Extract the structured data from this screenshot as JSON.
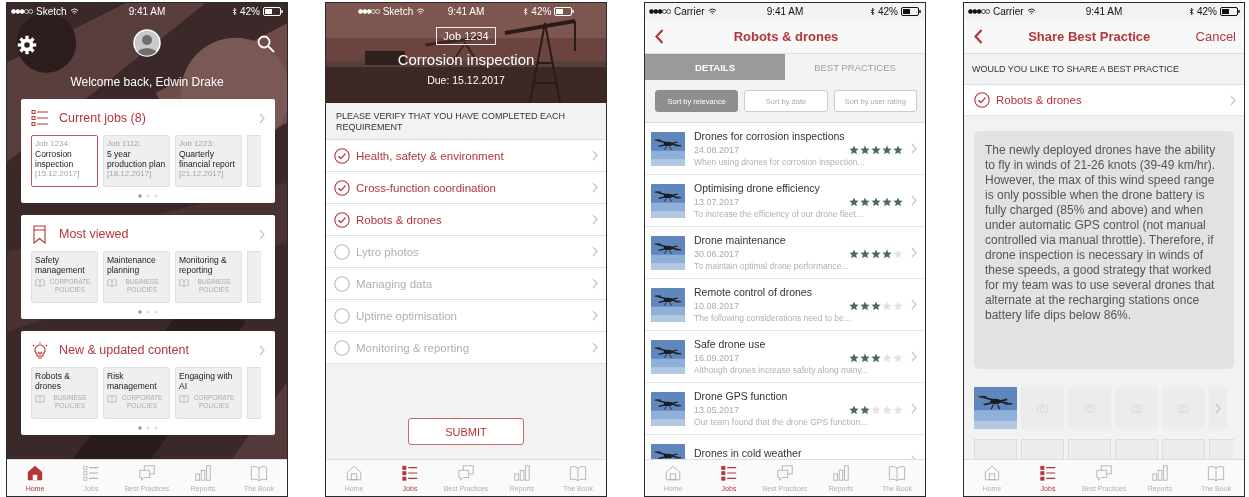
{
  "screens": [
    {
      "kind": "home",
      "status_bar": {
        "carrier": "Sketch",
        "time": "9:41 AM",
        "battery": "42%"
      },
      "greeting": "Welcome back, Edwin Drake",
      "sections": [
        {
          "kind": "jobs",
          "title": "Current jobs (8)",
          "tiles": [
            {
              "label": "Job 1234:",
              "title": "Corrosion inspection",
              "date": "[15.12.2017]",
              "selected": true
            },
            {
              "label": "Job 1112:",
              "title": "5 year production plan",
              "date": "[18.12.2017]",
              "selected": false
            },
            {
              "label": "Job 1223:",
              "title": "Quarterly financial report",
              "date": "[21.12.2017]",
              "selected": false
            }
          ]
        },
        {
          "kind": "viewed",
          "title": "Most viewed",
          "tiles": [
            {
              "title": "Safety management",
              "category": "CORPORATE POLICIES"
            },
            {
              "title": "Maintenance planning",
              "category": "BUSINESS POLICIES"
            },
            {
              "title": "Monitoring & reporting",
              "category": "BUSINESS POLICIES"
            }
          ]
        },
        {
          "kind": "new",
          "title": "New & updated content",
          "tiles": [
            {
              "title": "Robots & drones",
              "category": "BUSINESS POLICIES"
            },
            {
              "title": "Risk management",
              "category": "CORPORATE POLICIES"
            },
            {
              "title": "Engaging with AI",
              "category": "CORPORATE POLICIES"
            }
          ]
        }
      ],
      "tab_bar": [
        {
          "label": "Home",
          "selected": true
        },
        {
          "label": "Jobs",
          "selected": false
        },
        {
          "label": "Best Practices",
          "selected": false
        },
        {
          "label": "Reports",
          "selected": false
        },
        {
          "label": "The Book",
          "selected": false
        }
      ]
    },
    {
      "kind": "checklist",
      "status_bar": {
        "carrier": "Sketch",
        "time": "9:41 AM",
        "battery": "42%"
      },
      "job_badge": "Job 1234",
      "title": "Corrosion inspection",
      "due": "Due: 15.12.2017",
      "instruction": "PLEASE VERIFY THAT YOU HAVE COMPLETED EACH REQUIREMENT",
      "requirements": [
        {
          "label": "Health, safety & environment",
          "checked": true
        },
        {
          "label": "Cross-function coordination",
          "checked": true
        },
        {
          "label": "Robots & drones",
          "checked": true
        },
        {
          "label": "Lytro photos",
          "checked": false
        },
        {
          "label": "Managing data",
          "checked": false
        },
        {
          "label": "Uptime optimisation",
          "checked": false
        },
        {
          "label": "Monitoring & reporting",
          "checked": false
        }
      ],
      "submit": "SUBMIT",
      "tab_bar": [
        {
          "label": "Home",
          "selected": false
        },
        {
          "label": "Jobs",
          "selected": true
        },
        {
          "label": "Best Practices",
          "selected": false
        },
        {
          "label": "Reports",
          "selected": false
        },
        {
          "label": "The Book",
          "selected": false
        }
      ]
    },
    {
      "kind": "list",
      "status_bar": {
        "carrier": "Carrier",
        "time": "9:41 AM",
        "battery": "42%"
      },
      "title": "Robots & drones",
      "tabs": [
        {
          "label": "DETAILS",
          "selected": true
        },
        {
          "label": "BEST PRACTICES",
          "selected": false
        }
      ],
      "sort_options": [
        {
          "label": "Sort by relevance",
          "selected": true
        },
        {
          "label": "Sort by date",
          "selected": false
        },
        {
          "label": "Sort by user rating",
          "selected": false
        }
      ],
      "items": [
        {
          "title": "Drones for corrosion inspections",
          "date": "24.08.2017",
          "stars": 5,
          "snippet": "When using drones for corrosion inspection..."
        },
        {
          "title": "Optimising drone efficiency",
          "date": "13.07.2017",
          "stars": 5,
          "snippet": "To increase the efficiency of our drone fleet..."
        },
        {
          "title": "Drone maintenance",
          "date": "30.06.2017",
          "stars": 4,
          "snippet": "To maintain optimal drone performance..."
        },
        {
          "title": "Remote control of drones",
          "date": "10.08.2017",
          "stars": 3,
          "snippet": "The following considerations need to be..."
        },
        {
          "title": "Safe drone use",
          "date": "16.09.2017",
          "stars": 3,
          "snippet": "Although drones increase safety along many..."
        },
        {
          "title": "Drone GPS function",
          "date": "13.05.2017",
          "stars": 2,
          "snippet": "Our team found that the drone GPS function..."
        },
        {
          "title": "Drones in cold weather"
        }
      ],
      "tab_bar": [
        {
          "label": "Home",
          "selected": false
        },
        {
          "label": "Jobs",
          "selected": true
        },
        {
          "label": "Best Practices",
          "selected": false
        },
        {
          "label": "Reports",
          "selected": false
        },
        {
          "label": "The Book",
          "selected": false
        }
      ]
    },
    {
      "kind": "share",
      "status_bar": {
        "carrier": "Carrier",
        "time": "9:41 AM",
        "battery": "42%"
      },
      "title": "Share Best Practice",
      "cancel": "Cancel",
      "prompt": "WOULD YOU LIKE TO SHARE A BEST PRACTICE",
      "topic": {
        "label": "Robots & drones",
        "checked": true
      },
      "description": "The newly deployed drones have the ability to fly in winds of 21-26 knots (39-49 km/hr). However, the max of this wind speed range is only possible when the drone battery is fully charged (85% and above) and when under automatic GPS control (not manual controlled via manual throttle). Therefore, if drone inspection is necessary in winds of these speeds, a good strategy that worked for my team was to use several drones that alternate at the recharging stations once battery life dips below 86%.",
      "photo_rows": [
        [
          {
            "kind": "picture"
          },
          {
            "kind": "empty"
          },
          {
            "kind": "empty"
          },
          {
            "kind": "empty"
          },
          {
            "kind": "empty"
          },
          {
            "kind": "more"
          }
        ],
        [
          {
            "kind": "blank"
          },
          {
            "kind": "blank"
          },
          {
            "kind": "blank"
          },
          {
            "kind": "blank"
          },
          {
            "kind": "blank"
          },
          {
            "kind": "blank"
          }
        ]
      ],
      "tab_bar": [
        {
          "label": "Home",
          "selected": false
        },
        {
          "label": "Jobs",
          "selected": true
        },
        {
          "label": "Best Practices",
          "selected": false
        },
        {
          "label": "Reports",
          "selected": false
        },
        {
          "label": "The Book",
          "selected": false
        }
      ]
    }
  ]
}
